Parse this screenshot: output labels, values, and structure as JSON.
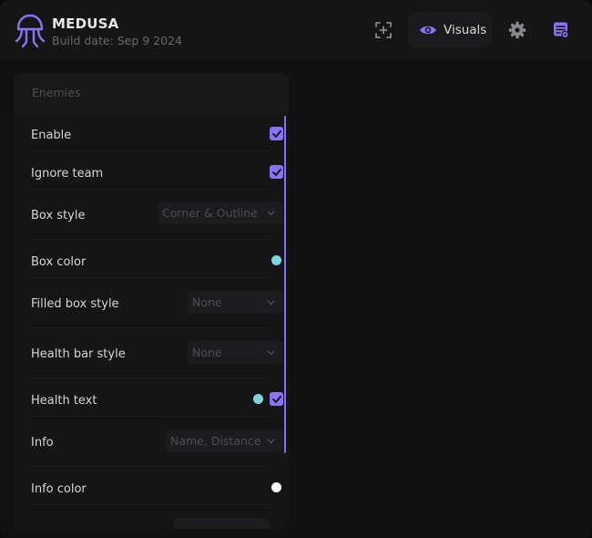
{
  "app": {
    "name": "MEDUSA",
    "build_date": "Build date: Sep 9 2024"
  },
  "toolbar": {
    "visuals_label": "Visuals"
  },
  "panel": {
    "title": "Enemies",
    "rows": [
      {
        "label": "Enable",
        "control": "checkbox",
        "checked": true
      },
      {
        "label": "Ignore team",
        "control": "checkbox",
        "checked": true
      },
      {
        "label": "Box style",
        "control": "select",
        "value": "Corner & Outline"
      },
      {
        "label": "Box color",
        "control": "color",
        "color": "#7fd3df"
      },
      {
        "label": "Filled box style",
        "control": "select",
        "value": "None"
      },
      {
        "label": "Health bar style",
        "control": "select",
        "value": "None"
      },
      {
        "label": "Health text",
        "control": "color+checkbox",
        "color": "#7fd3df",
        "checked": true
      },
      {
        "label": "Info",
        "control": "select",
        "value": "Name, Distance"
      },
      {
        "label": "Info color",
        "control": "color",
        "color": "#ffffff"
      }
    ]
  },
  "colors": {
    "accent": "#8a72f2",
    "cyan": "#7fd3df",
    "white": "#ffffff"
  },
  "icons": [
    "medusa-logo",
    "capture-icon",
    "eye-icon",
    "gear-icon",
    "config-icon",
    "checkmark-icon",
    "chevron-down-icon"
  ]
}
